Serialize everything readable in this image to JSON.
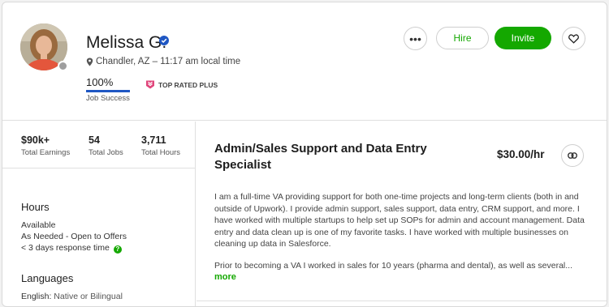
{
  "profile": {
    "name": "Melissa G.",
    "location": "Chandler, AZ – 11:17 am local time",
    "job_success_value": "100%",
    "job_success_label": "Job Success",
    "job_success_fraction": 1.0,
    "badge": "TOP RATED PLUS"
  },
  "actions": {
    "more": "•••",
    "hire": "Hire",
    "invite": "Invite"
  },
  "stats": [
    {
      "value": "$90k+",
      "label": "Total Earnings"
    },
    {
      "value": "54",
      "label": "Total Jobs"
    },
    {
      "value": "3,711",
      "label": "Total Hours"
    }
  ],
  "hours": {
    "title": "Hours",
    "lines": [
      "Available",
      "As Needed - Open to Offers",
      "< 3 days response time"
    ]
  },
  "languages": {
    "title": "Languages",
    "items": [
      {
        "name": "English:",
        "level": "Native or Bilingual"
      }
    ]
  },
  "listing": {
    "title": "Admin/Sales Support and Data Entry Specialist",
    "rate": "$30.00/hr",
    "description_lines": [
      "I am a full-time VA providing support for both one-time projects and long-term clients (both in and",
      "outside of Upwork). I provide admin support, sales support, data entry, CRM support, and more. I",
      "have worked with multiple startups to help set up SOPs for admin and account management. Data",
      "entry and data clean up is one of my favorite tasks. I have worked with multiple businesses on",
      "cleaning up data in Salesforce."
    ],
    "description_more": "Prior to becoming a VA I worked in sales for 10 years (pharma and dental), as well as several...",
    "more_label": "more"
  },
  "colors": {
    "brand_green": "#14a800",
    "job_success_bar": "#1f57c3",
    "verified_blue": "#1f57c3",
    "top_rated_pink": "#e0457b"
  },
  "icons": {
    "verified": "verified-check-icon",
    "location": "map-pin-icon",
    "badge": "top-rated-plus-icon",
    "heart": "heart-icon",
    "link": "link-icon",
    "help": "question-icon"
  }
}
